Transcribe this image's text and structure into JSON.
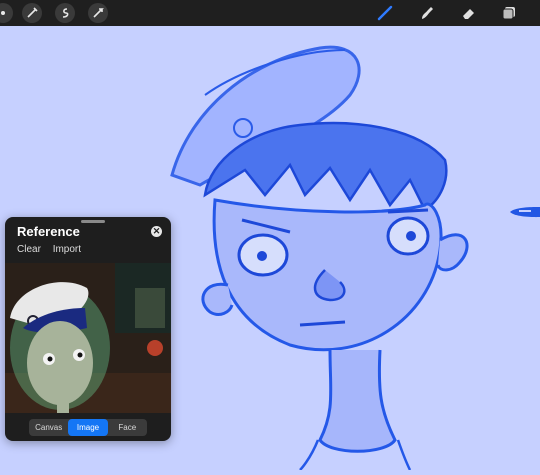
{
  "toolbar": {
    "left_tools": [
      "adjustments-icon",
      "selection-icon",
      "transform-icon",
      "actions-icon"
    ],
    "right_tools": [
      "brush-icon",
      "smudge-icon",
      "eraser-icon",
      "layers-icon"
    ],
    "active_tool": "brush",
    "accent": "#2f7bff"
  },
  "reference": {
    "title": "Reference",
    "clear_label": "Clear",
    "import_label": "Import",
    "modes": [
      "Canvas",
      "Image",
      "Face"
    ],
    "selected_mode": "Image"
  },
  "colors": {
    "canvas": "#c6d0ff",
    "stroke": "#2155e8",
    "panel": "#1e1e1e",
    "accent": "#1476f5"
  }
}
